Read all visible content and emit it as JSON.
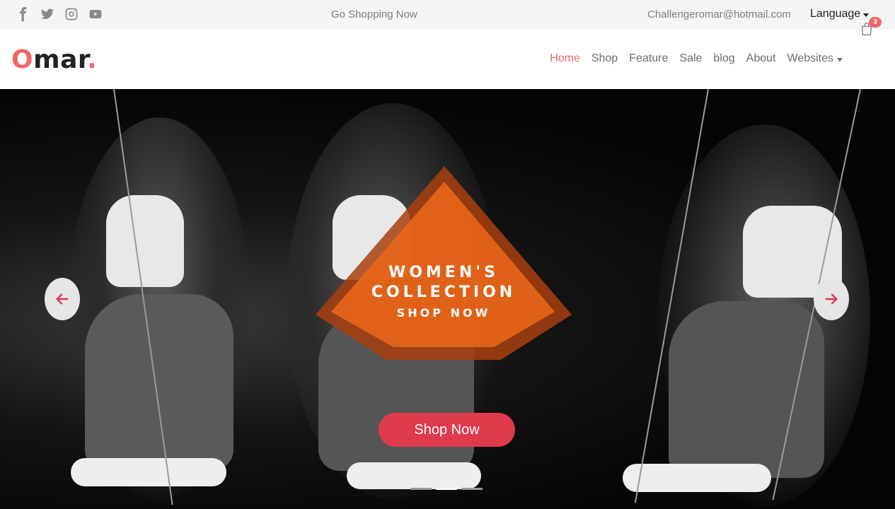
{
  "topbar": {
    "social_icons": [
      "facebook-icon",
      "twitter-icon",
      "instagram-icon",
      "youtube-icon"
    ],
    "center_text": "Go Shopping Now",
    "email": "Challengeromar@hotmail.com",
    "language": "Language"
  },
  "navbar": {
    "logo_first": "O",
    "logo_rest": "mar",
    "logo_dot": ".",
    "items": [
      {
        "label": "Home",
        "active": true
      },
      {
        "label": "Shop"
      },
      {
        "label": "Feature"
      },
      {
        "label": "Sale"
      },
      {
        "label": "blog"
      },
      {
        "label": "About"
      },
      {
        "label": "Websites",
        "dropdown": true
      }
    ],
    "cart_count": "3"
  },
  "hero": {
    "line1": "WOMEN'S",
    "line2": "COLLECTION",
    "line3": "SHOP NOW",
    "button": "Shop Now",
    "slides": 3,
    "active_slide": 2
  },
  "colors": {
    "accent": "#f06767",
    "button": "#e03a4d",
    "diamond": "#e8661a",
    "diamond_dark": "#a8400f"
  }
}
